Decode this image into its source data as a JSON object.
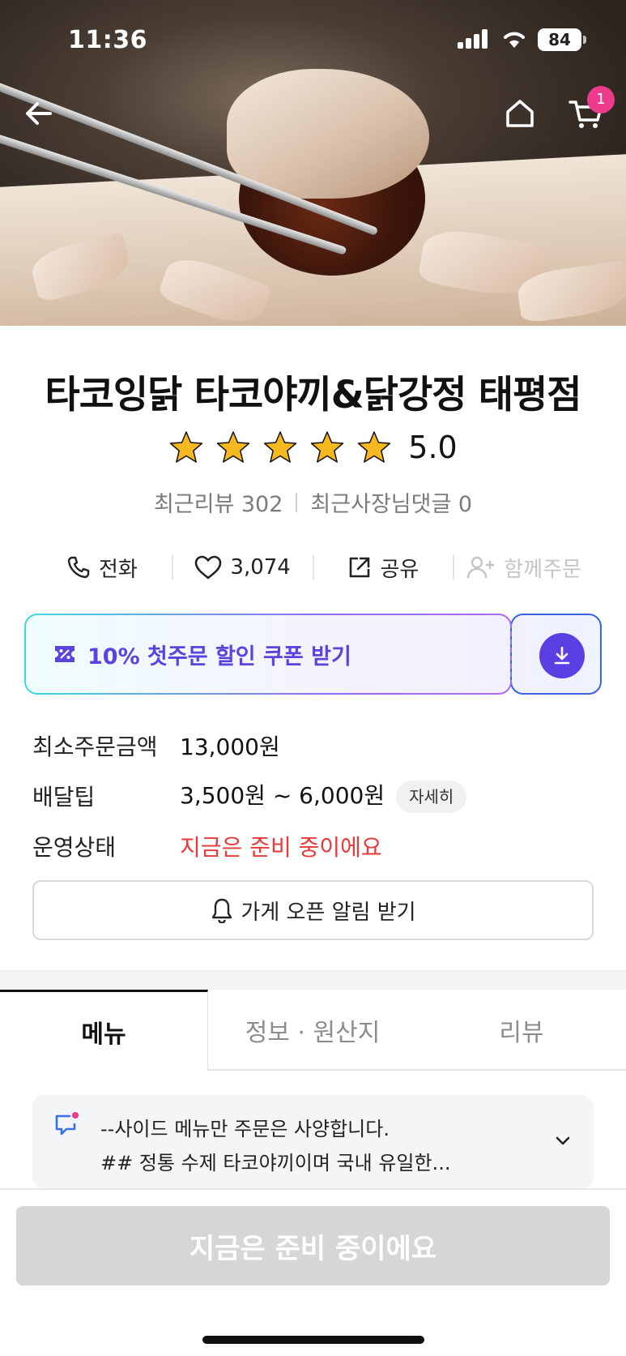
{
  "status_bar": {
    "time": "11:36",
    "battery": "84"
  },
  "header": {
    "cart_count": "1"
  },
  "store": {
    "name": "타코잉닭 타코야끼&닭강정 태평점",
    "rating": "5.0",
    "stars": 5,
    "recent_reviews": "최근리뷰 302",
    "owner_replies": "최근사장님댓글 0"
  },
  "actions": {
    "call": "전화",
    "likes": "3,074",
    "share": "공유",
    "group_order": "함께주문"
  },
  "coupon": {
    "label": "10% 첫주문 할인 쿠폰 받기"
  },
  "info": {
    "min_order_label": "최소주문금액",
    "min_order_value": "13,000원",
    "delivery_tip_label": "배달팁",
    "delivery_tip_value": "3,500원 ~ 6,000원",
    "detail_button": "자세히",
    "status_label": "운영상태",
    "status_value": "지금은 준비 중이에요"
  },
  "notify_button": "가게 오픈 알림 받기",
  "tabs": [
    {
      "label": "메뉴",
      "active": true
    },
    {
      "label": "정보 · 원산지",
      "active": false
    },
    {
      "label": "리뷰",
      "active": false
    }
  ],
  "notice": {
    "line1": "--사이드 메뉴만 주문은 사양합니다.",
    "line2": "## 정통 수제 타코야끼이며 국내 유일한..."
  },
  "order_button": "지금은 준비 중이에요",
  "colors": {
    "accent": "#5b3fe3",
    "status_red": "#e73a3a",
    "badge_pink": "#ec3a8c",
    "star": "#f6b81f"
  }
}
